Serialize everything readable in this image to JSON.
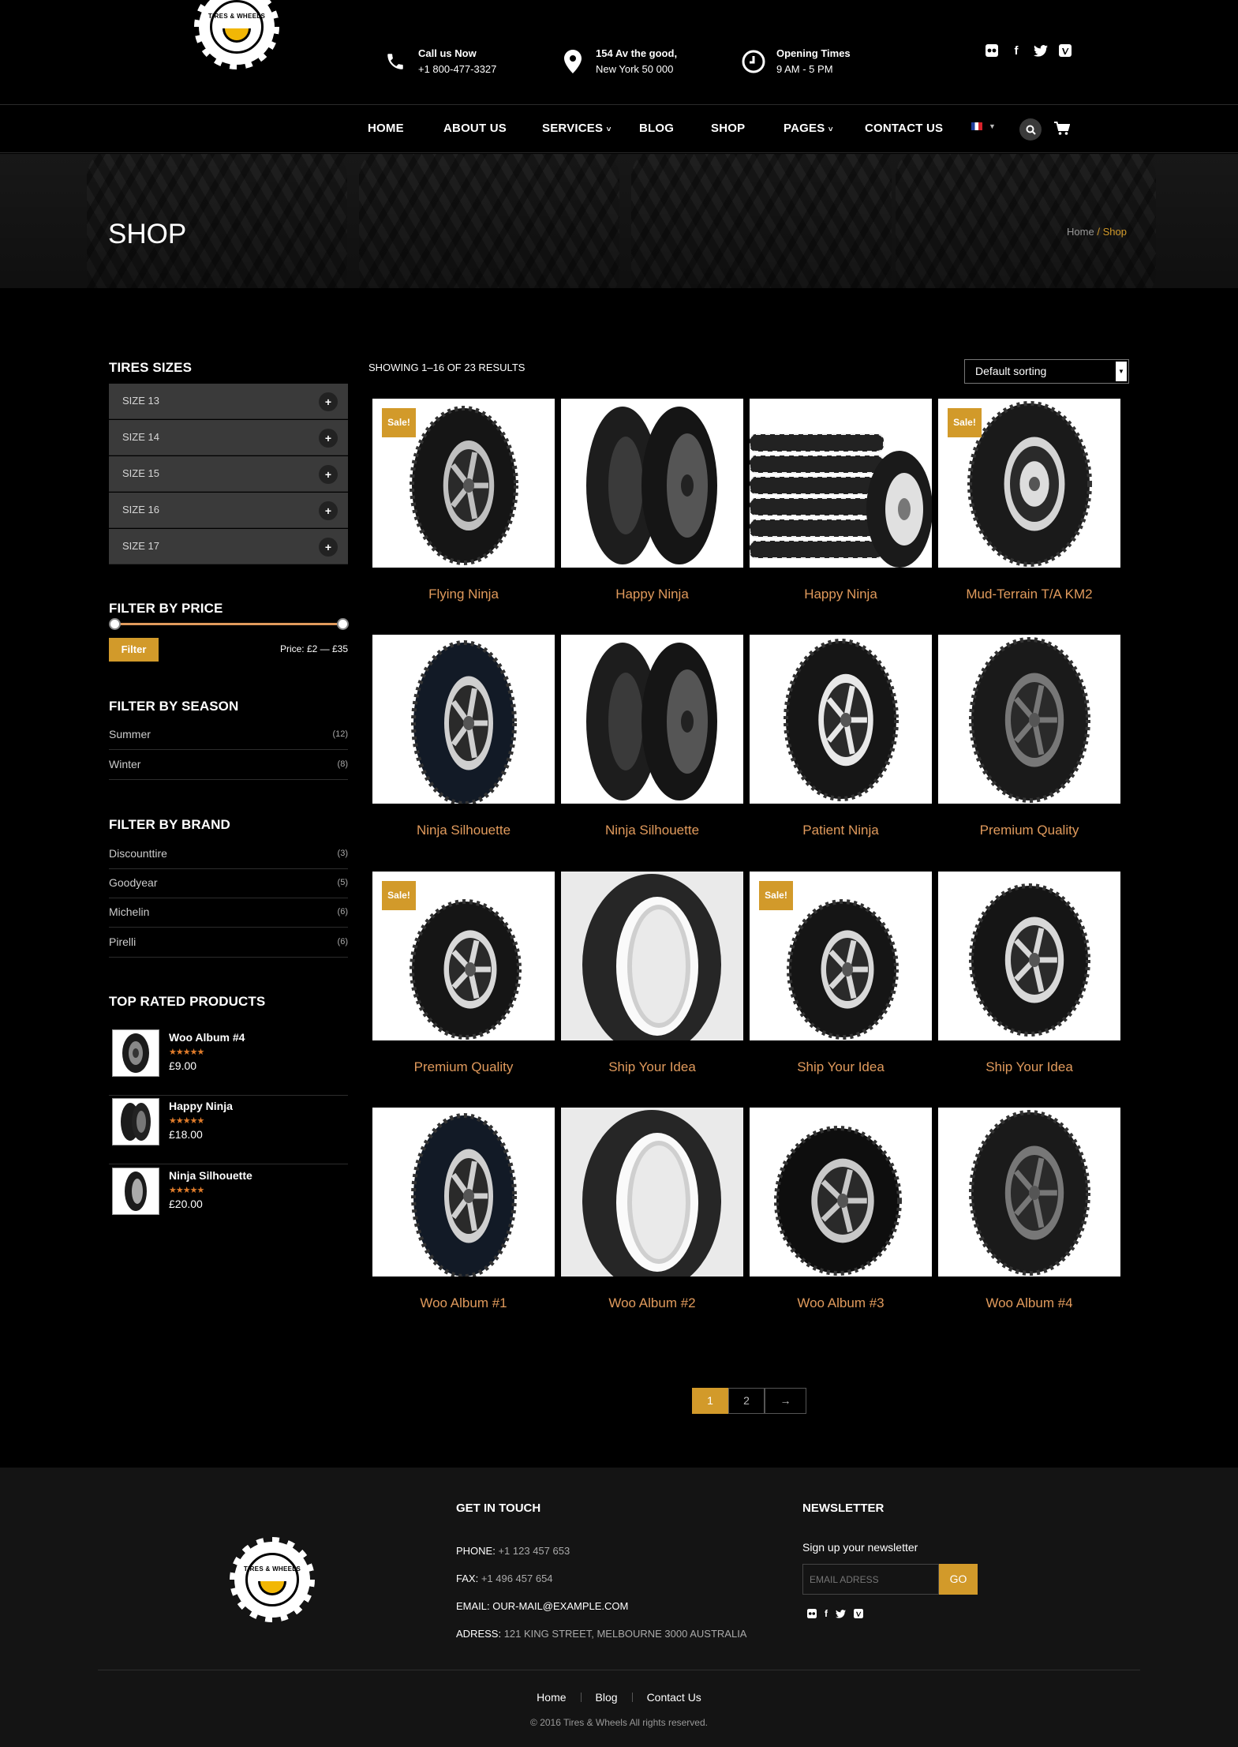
{
  "brand": {
    "logo_text": "TIRES & WHEELS",
    "accent": "#d29a2a"
  },
  "header": {
    "call": {
      "title": "Call us Now",
      "value": "+1 800-477-3327",
      "icon": "phone-icon"
    },
    "address": {
      "title": "154 Av the good,",
      "value": "New York 50 000",
      "icon": "map-pin-icon"
    },
    "hours": {
      "title": "Opening Times",
      "value": "9 AM - 5 PM",
      "icon": "clock-icon"
    },
    "social": [
      "flickr-icon",
      "facebook-icon",
      "twitter-icon",
      "vimeo-icon"
    ]
  },
  "nav": {
    "items": [
      "HOME",
      "ABOUT US",
      "SERVICES",
      "BLOG",
      "SHOP",
      "PAGES",
      "CONTACT US"
    ],
    "language": "French flag",
    "search_icon": "search-icon",
    "cart_icon": "cart-icon"
  },
  "banner": {
    "title": "SHOP",
    "breadcrumb_home": "Home",
    "breadcrumb_sep": "/",
    "breadcrumb_current": "Shop"
  },
  "sidebar": {
    "sizes_title": "TIRES SIZES",
    "sizes": [
      "SIZE 13",
      "SIZE 14",
      "SIZE 15",
      "SIZE 16",
      "SIZE 17"
    ],
    "price_title": "FILTER BY PRICE",
    "filter_button": "Filter",
    "price_range": "Price: £2 — £35",
    "season_title": "FILTER BY SEASON",
    "seasons": [
      {
        "name": "Summer",
        "count": "(12)"
      },
      {
        "name": "Winter",
        "count": "(8)"
      }
    ],
    "brand_title": "FILTER BY BRAND",
    "brands": [
      {
        "name": "Discounttire",
        "count": "(3)"
      },
      {
        "name": "Goodyear",
        "count": "(5)"
      },
      {
        "name": "Michelin",
        "count": "(6)"
      },
      {
        "name": "Pirelli",
        "count": "(6)"
      }
    ],
    "top_title": "TOP RATED PRODUCTS",
    "top_rated": [
      {
        "name": "Woo Album #4",
        "stars": "★★★★★",
        "price": "£9.00"
      },
      {
        "name": "Happy Ninja",
        "stars": "★★★★★",
        "price": "£18.00"
      },
      {
        "name": "Ninja Silhouette",
        "stars": "★★★★★",
        "price": "£20.00"
      }
    ]
  },
  "shop": {
    "results": "SHOWING 1–16 OF 23 RESULTS",
    "sorting": "Default sorting",
    "sale_label": "Sale!",
    "products": [
      {
        "name": "Flying Ninja",
        "sale": true
      },
      {
        "name": "Happy Ninja",
        "sale": false
      },
      {
        "name": "Happy Ninja",
        "sale": false
      },
      {
        "name": "Mud-Terrain T/A KM2",
        "sale": true
      },
      {
        "name": "Ninja Silhouette",
        "sale": false
      },
      {
        "name": "Ninja Silhouette",
        "sale": false
      },
      {
        "name": "Patient Ninja",
        "sale": false
      },
      {
        "name": "Premium Quality",
        "sale": false
      },
      {
        "name": "Premium Quality",
        "sale": true
      },
      {
        "name": "Ship Your Idea",
        "sale": false
      },
      {
        "name": "Ship Your Idea",
        "sale": true
      },
      {
        "name": "Ship Your Idea",
        "sale": false
      },
      {
        "name": "Woo Album #1",
        "sale": false
      },
      {
        "name": "Woo Album #2",
        "sale": false
      },
      {
        "name": "Woo Album #3",
        "sale": false
      },
      {
        "name": "Woo Album #4",
        "sale": false
      }
    ],
    "pagination": [
      "1",
      "2",
      "→"
    ]
  },
  "footer": {
    "contact_title": "GET IN TOUCH",
    "phone_label": "PHONE:",
    "phone": "+1 123 457 653",
    "fax_label": "FAX:",
    "fax": "+1 496 457 654",
    "email_label": "EMAIL:",
    "email": "OUR-MAIL@EXAMPLE.COM",
    "address_label": "ADRESS:",
    "address": "121 KING STREET, MELBOURNE 3000 AUSTRALIA",
    "newsletter_title": "NEWSLETTER",
    "newsletter_text": "Sign up your newsletter",
    "email_placeholder": "EMAIL ADRESS",
    "go_button": "GO",
    "links": [
      "Home",
      "Blog",
      "Contact Us"
    ],
    "copyright": "© 2016 Tires & Wheels All rights reserved."
  }
}
